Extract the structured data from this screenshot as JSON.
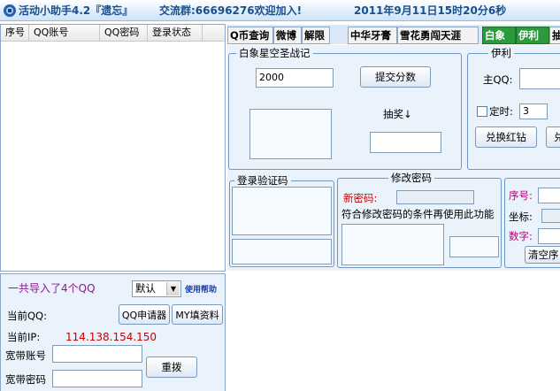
{
  "titlebar": {
    "app_name": "活动小助手4.2『遗忘』",
    "qq_group": "交流群:66696276欢迎加入!",
    "datetime": "2011年9月11日15时20分6秒"
  },
  "list": {
    "columns": [
      "序号",
      "QQ账号",
      "QQ密码",
      "登录状态"
    ]
  },
  "tabs": [
    {
      "label": "Q币查询"
    },
    {
      "label": "微博"
    },
    {
      "label": "解限"
    },
    {
      "label": "中华牙膏"
    },
    {
      "label": "雪花勇闯天涯"
    },
    {
      "label": "白象"
    },
    {
      "label": "伊利"
    },
    {
      "label": "抽"
    }
  ],
  "baixiang": {
    "title": "白象星空圣战记",
    "score_value": "2000",
    "submit_label": "提交分数",
    "lottery_label": "抽奖↓"
  },
  "yili": {
    "title": "伊利",
    "main_qq_label": "主QQ:",
    "timer_label": "定时:",
    "timer_value": "3",
    "redeem_label": "兑换红钻",
    "cut_label": "兑"
  },
  "login_captcha": {
    "title": "登录验证码"
  },
  "change_password": {
    "title": "修改密码",
    "new_password_label": "新密码:",
    "hint": "符合修改密码的条件再使用此功能"
  },
  "serial_box": {
    "serial_label": "序号:",
    "coord_label": "坐标:",
    "digit_label": "数字:",
    "clear_label": "清空序"
  },
  "bottom": {
    "import_count": "一共导入了4个QQ",
    "select_value": "默认",
    "help_label": "使用帮助",
    "current_qq_label": "当前QQ:",
    "qq_apply_label": "QQ申请器",
    "my_fill_label": "MY填资料",
    "current_ip_label": "当前IP:",
    "current_ip_value": "114.138.154.150",
    "broadband_account_label": "宽带账号",
    "broadband_password_label": "宽带密码",
    "redial_label": "重拨"
  },
  "colors": {
    "title_text": "#1a4e8c",
    "active_tab": "#2a9a3a",
    "red_label": "#cc0000",
    "purple_text": "#8b1a8b",
    "magenta_label": "#b0007a",
    "ip_red": "#cc0000"
  }
}
